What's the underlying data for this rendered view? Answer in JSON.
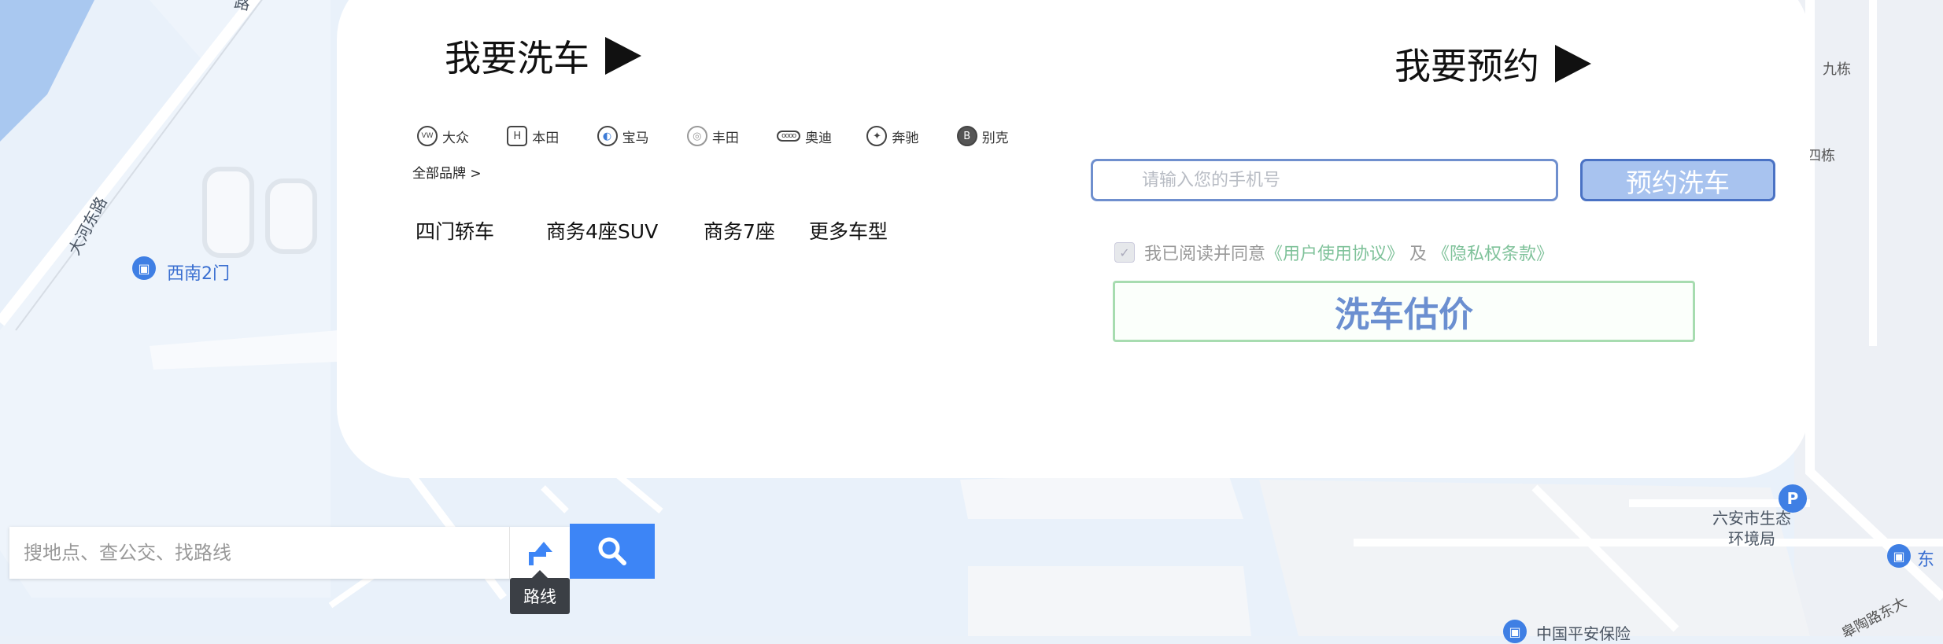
{
  "map": {
    "labels": {
      "road_north": "路",
      "road_west": "大河东路",
      "poi_gate": "西南2门",
      "block_nine": "九栋",
      "block_four": "四栋",
      "poi_env": "六安市生态\n环境局",
      "poi_east": "东",
      "poi_insurance": "中国平安保险",
      "road_south": "皋陶路东大"
    },
    "parking_icon": "P",
    "poi_icon": "building-marker-icon"
  },
  "wash": {
    "heading": "我要洗车",
    "brands": [
      {
        "name": "大众",
        "logo": "vw-logo-icon",
        "glyph": "VW"
      },
      {
        "name": "本田",
        "logo": "honda-logo-icon",
        "glyph": "H"
      },
      {
        "name": "宝马",
        "logo": "bmw-logo-icon",
        "glyph": "◐"
      },
      {
        "name": "丰田",
        "logo": "toyota-logo-icon",
        "glyph": "◎"
      },
      {
        "name": "奥迪",
        "logo": "audi-logo-icon",
        "glyph": "oooo"
      },
      {
        "name": "奔驰",
        "logo": "benz-logo-icon",
        "glyph": "✦"
      },
      {
        "name": "别克",
        "logo": "buick-logo-icon",
        "glyph": "B"
      }
    ],
    "all_brands": "全部品牌 >",
    "types": [
      "四门轿车",
      "商务4座SUV",
      "商务7座",
      "更多车型"
    ]
  },
  "booking": {
    "heading": "我要预约",
    "phone_placeholder": "请输入您的手机号",
    "book_button": "预约洗车",
    "agree_prefix": "我已阅读并同意",
    "agreement_link": "《用户使用协议》",
    "and": "及",
    "privacy_link": "《隐私权条款》",
    "estimate_button": "洗车估价",
    "checkbox_mark": "✓"
  },
  "search": {
    "placeholder": "搜地点、查公交、找路线",
    "route_tooltip": "路线"
  },
  "colors": {
    "map_water": "#a9c8f0",
    "map_land": "#eaf1f9",
    "accent_blue": "#3d85f6",
    "agree_link": "#7fc29a"
  }
}
